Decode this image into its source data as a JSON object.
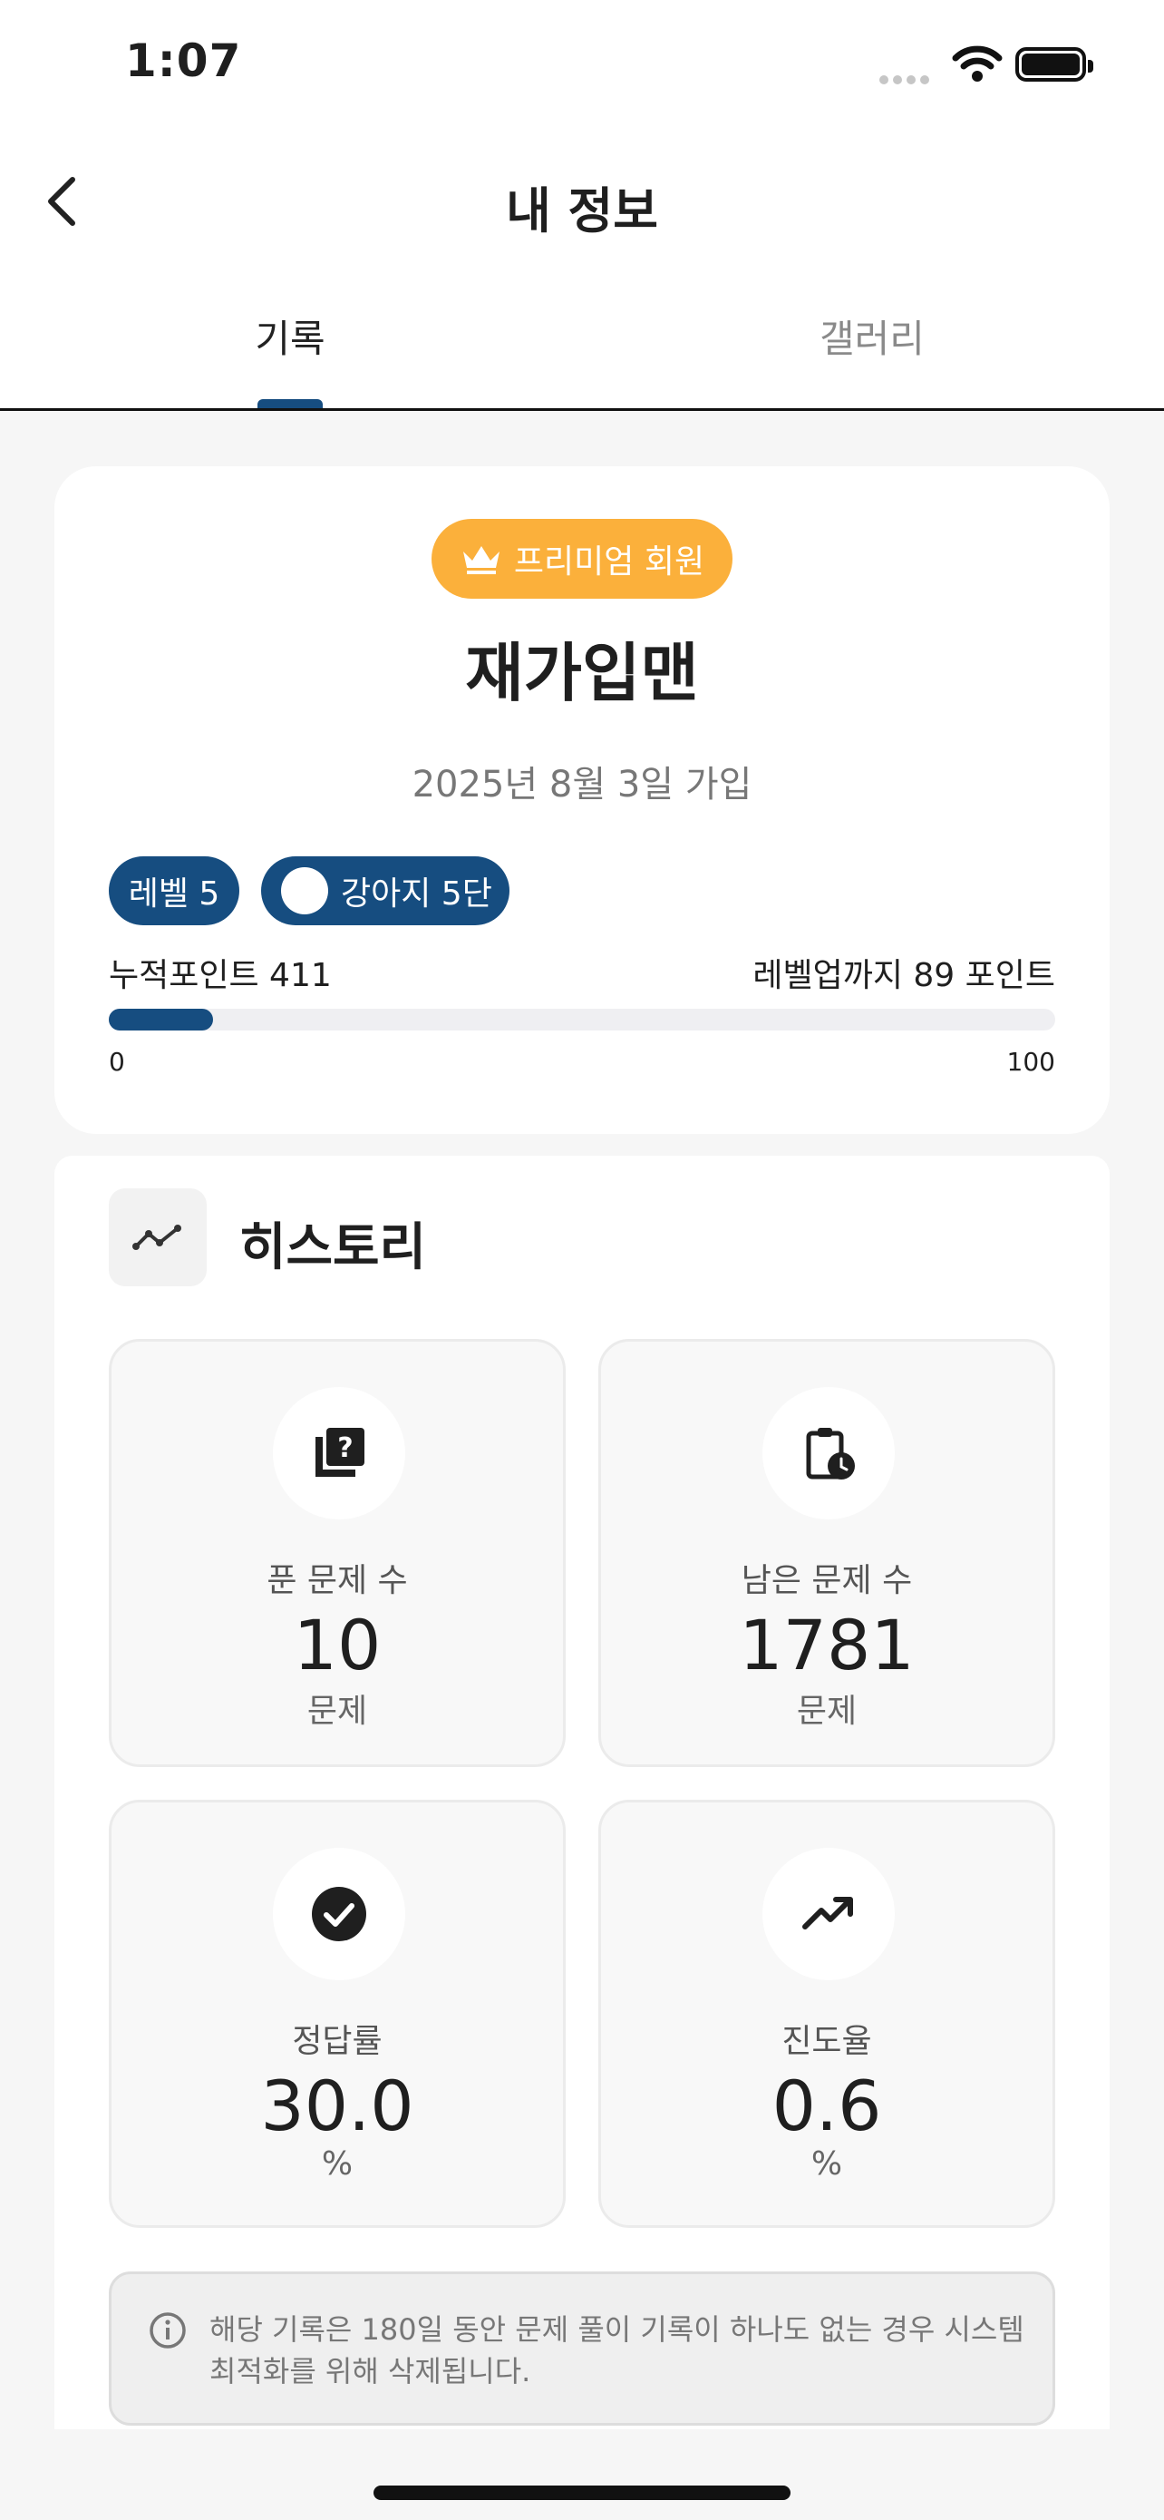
{
  "status_bar": {
    "time": "1:07"
  },
  "header": {
    "title": "내 정보"
  },
  "tabs": [
    {
      "label": "기록",
      "active": true
    },
    {
      "label": "갤러리",
      "active": false
    }
  ],
  "profile": {
    "badge": "프리미엄 회원",
    "name": "재가입맨",
    "joined": "2025년 8월 3일 가입",
    "level_pill": "레벨 5",
    "rank_pill": "강아지 5단",
    "points_left": "누적포인트 411",
    "points_right": "레벨업까지 89 포인트",
    "progress": {
      "value": 11,
      "min": "0",
      "max": "100"
    }
  },
  "history": {
    "title": "히스토리",
    "stats": [
      {
        "label": "푼 문제 수",
        "value": "10",
        "unit": "문제",
        "icon": "quiz-icon"
      },
      {
        "label": "남은 문제 수",
        "value": "1781",
        "unit": "문제",
        "icon": "clipboard-clock-icon"
      },
      {
        "label": "정답률",
        "value": "30.0",
        "unit": "%",
        "icon": "check-circle-icon"
      },
      {
        "label": "진도율",
        "value": "0.6",
        "unit": "%",
        "icon": "trending-up-icon"
      }
    ],
    "notice": "해당 기록은 180일 동안 문제 풀이 기록이 하나도 없는 경우 시스템 최적화를 위해 삭제됩니다."
  },
  "colors": {
    "accent": "#164d80",
    "premium": "#fbb03b"
  }
}
